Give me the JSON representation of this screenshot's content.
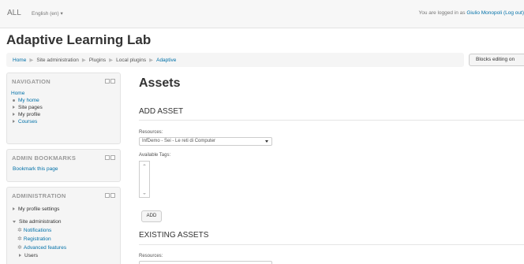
{
  "navbar": {
    "brand": "ALL",
    "language": "English (en) ▾",
    "login_prefix": "You are logged in as ",
    "user_name": "Giulio Monopoli",
    "logout_label": "(Log out)"
  },
  "header": {
    "site_title": "Adaptive Learning Lab",
    "breadcrumb": [
      "Home",
      "Site administration",
      "Plugins",
      "Local plugins",
      "Adaptive"
    ],
    "blocks_editing_button": "Blocks editing on"
  },
  "navigation_block": {
    "title": "NAVIGATION",
    "home": "Home",
    "items": [
      "My home",
      "Site pages",
      "My profile",
      "Courses"
    ]
  },
  "admin_bookmarks_block": {
    "title": "ADMIN BOOKMARKS",
    "link": "Bookmark this page"
  },
  "administration_block": {
    "title": "ADMINISTRATION",
    "items": [
      "My profile settings",
      "Site administration",
      "Notifications",
      "Registration",
      "Advanced features",
      "Users"
    ]
  },
  "main": {
    "heading": "Assets",
    "add_asset": {
      "heading": "ADD ASSET",
      "resources_label": "Resources:",
      "resources_value": "InfDemo - Sei - Le reti di Computer",
      "tags_label": "Available Tags:",
      "add_button": "ADD"
    },
    "existing_assets": {
      "heading": "EXISTING ASSETS",
      "resources_label": "Resources:"
    }
  }
}
